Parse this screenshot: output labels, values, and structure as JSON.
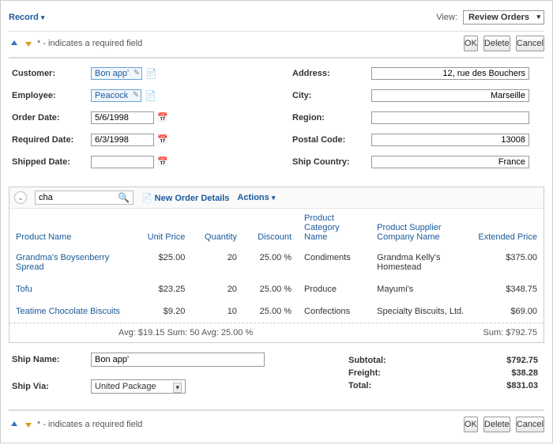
{
  "topbar": {
    "record_menu": "Record",
    "view_label": "View:",
    "view_value": "Review Orders"
  },
  "hint": "* - indicates a required field",
  "buttons": {
    "ok": "OK",
    "delete": "Delete",
    "cancel": "Cancel"
  },
  "fields": {
    "customer": {
      "label": "Customer:",
      "value": "Bon app'"
    },
    "employee": {
      "label": "Employee:",
      "value": "Peacock"
    },
    "order_date": {
      "label": "Order Date:",
      "value": "5/6/1998"
    },
    "required_date": {
      "label": "Required Date:",
      "value": "6/3/1998"
    },
    "shipped_date": {
      "label": "Shipped Date:",
      "value": ""
    },
    "address": {
      "label": "Address:",
      "value": "12, rue des Bouchers"
    },
    "city": {
      "label": "City:",
      "value": "Marseille"
    },
    "region": {
      "label": "Region:",
      "value": ""
    },
    "postal_code": {
      "label": "Postal Code:",
      "value": "13008"
    },
    "ship_country": {
      "label": "Ship Country:",
      "value": "France"
    }
  },
  "grid": {
    "search_value": "cha",
    "new_label": "New Order Details",
    "actions_label": "Actions",
    "headers": {
      "product": "Product Name",
      "price": "Unit Price",
      "qty": "Quantity",
      "discount": "Discount",
      "category": "Product Category Name",
      "supplier": "Product Supplier Company Name",
      "extended": "Extended Price"
    },
    "rows": [
      {
        "product": "Grandma's Boysenberry Spread",
        "price": "$25.00",
        "qty": "20",
        "discount": "25.00 %",
        "category": "Condiments",
        "supplier": "Grandma Kelly's Homestead",
        "extended": "$375.00"
      },
      {
        "product": "Tofu",
        "price": "$23.25",
        "qty": "20",
        "discount": "25.00 %",
        "category": "Produce",
        "supplier": "Mayumi's",
        "extended": "$348.75"
      },
      {
        "product": "Teatime Chocolate Biscuits",
        "price": "$9.20",
        "qty": "10",
        "discount": "25.00 %",
        "category": "Confections",
        "supplier": "Specialty Biscuits, Ltd.",
        "extended": "$69.00"
      }
    ],
    "footer": {
      "left": "Avg: $19.15  Sum: 50  Avg: 25.00 %",
      "right": "Sum: $792.75"
    }
  },
  "totals": {
    "subtotal_label": "Subtotal:",
    "subtotal_value": "$792.75",
    "freight_label": "Freight:",
    "freight_value": "$38.28",
    "total_label": "Total:",
    "total_value": "$831.03"
  },
  "ship": {
    "name_label": "Ship Name:",
    "name_value": "Bon app'",
    "via_label": "Ship Via:",
    "via_value": "United Package"
  }
}
